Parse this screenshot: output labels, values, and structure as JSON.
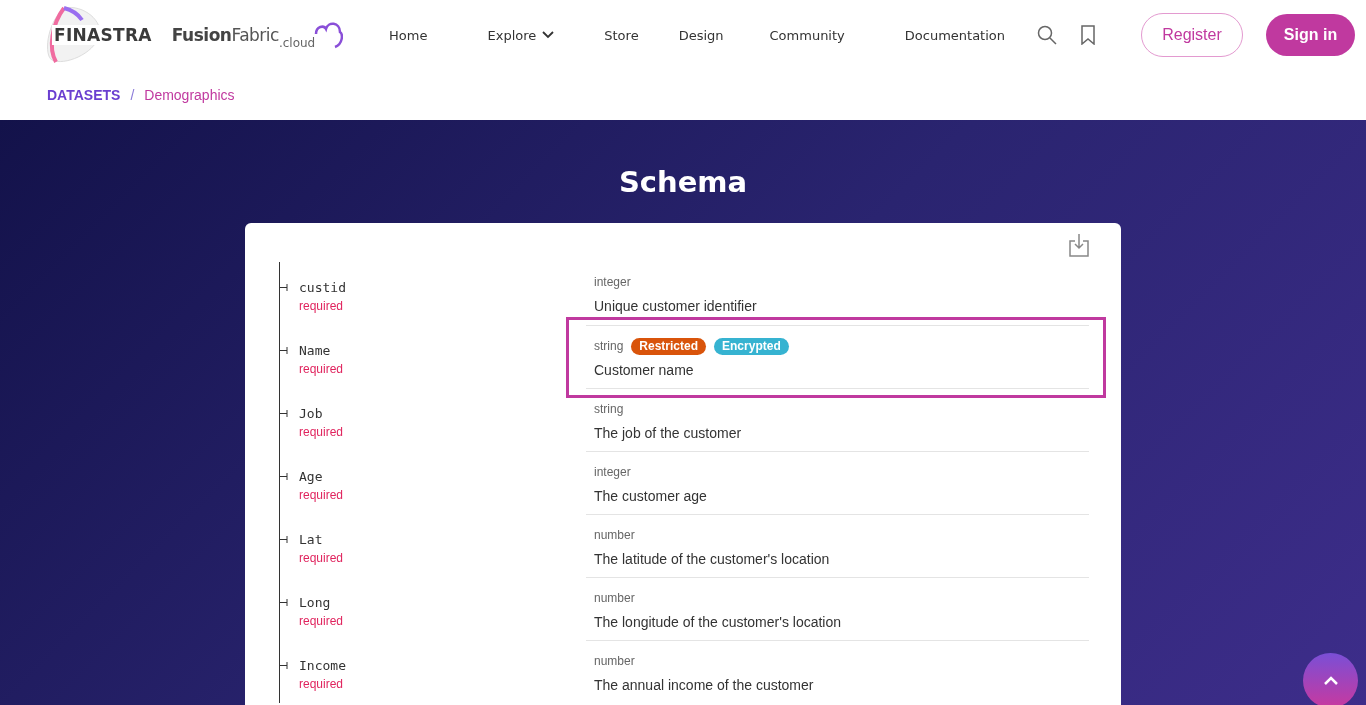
{
  "logo": {
    "brand": "FINASTRA",
    "product": "**Fusion**Fabric",
    "suffix": ".cloud"
  },
  "nav": [
    {
      "label": "Home",
      "dropdown": false
    },
    {
      "label": "Explore",
      "dropdown": true
    },
    {
      "label": "Store",
      "dropdown": false
    },
    {
      "label": "Design",
      "dropdown": false
    },
    {
      "label": "Community",
      "dropdown": false
    },
    {
      "label": "Documentation",
      "dropdown": false
    }
  ],
  "actions": {
    "register": "Register",
    "signin": "Sign in"
  },
  "breadcrumb": {
    "items": [
      "DATASETS",
      "Demographics"
    ],
    "separator": "/"
  },
  "title": "Schema",
  "fields": [
    {
      "name": "custid",
      "required": "required",
      "type": "integer",
      "description": "Unique customer identifier",
      "highlighted": false
    },
    {
      "name": "Name",
      "required": "required",
      "type": "string",
      "tags": [
        {
          "label": "Restricted",
          "color": "#d9540b"
        },
        {
          "label": "Encrypted",
          "color": "#36b3d1"
        }
      ],
      "description": "Customer name",
      "highlighted": true
    },
    {
      "name": "Job",
      "required": "required",
      "type": "string",
      "description": "The job of the customer",
      "highlighted": false
    },
    {
      "name": "Age",
      "required": "required",
      "type": "integer",
      "description": "The customer age",
      "highlighted": false
    },
    {
      "name": "Lat",
      "required": "required",
      "type": "number",
      "description": "The latitude of the customer's location",
      "highlighted": false
    },
    {
      "name": "Long",
      "required": "required",
      "type": "number",
      "description": "The longitude of the customer's location",
      "highlighted": false
    },
    {
      "name": "Income",
      "required": "required",
      "type": "number",
      "description": "The annual income of the customer",
      "highlighted": false
    }
  ]
}
